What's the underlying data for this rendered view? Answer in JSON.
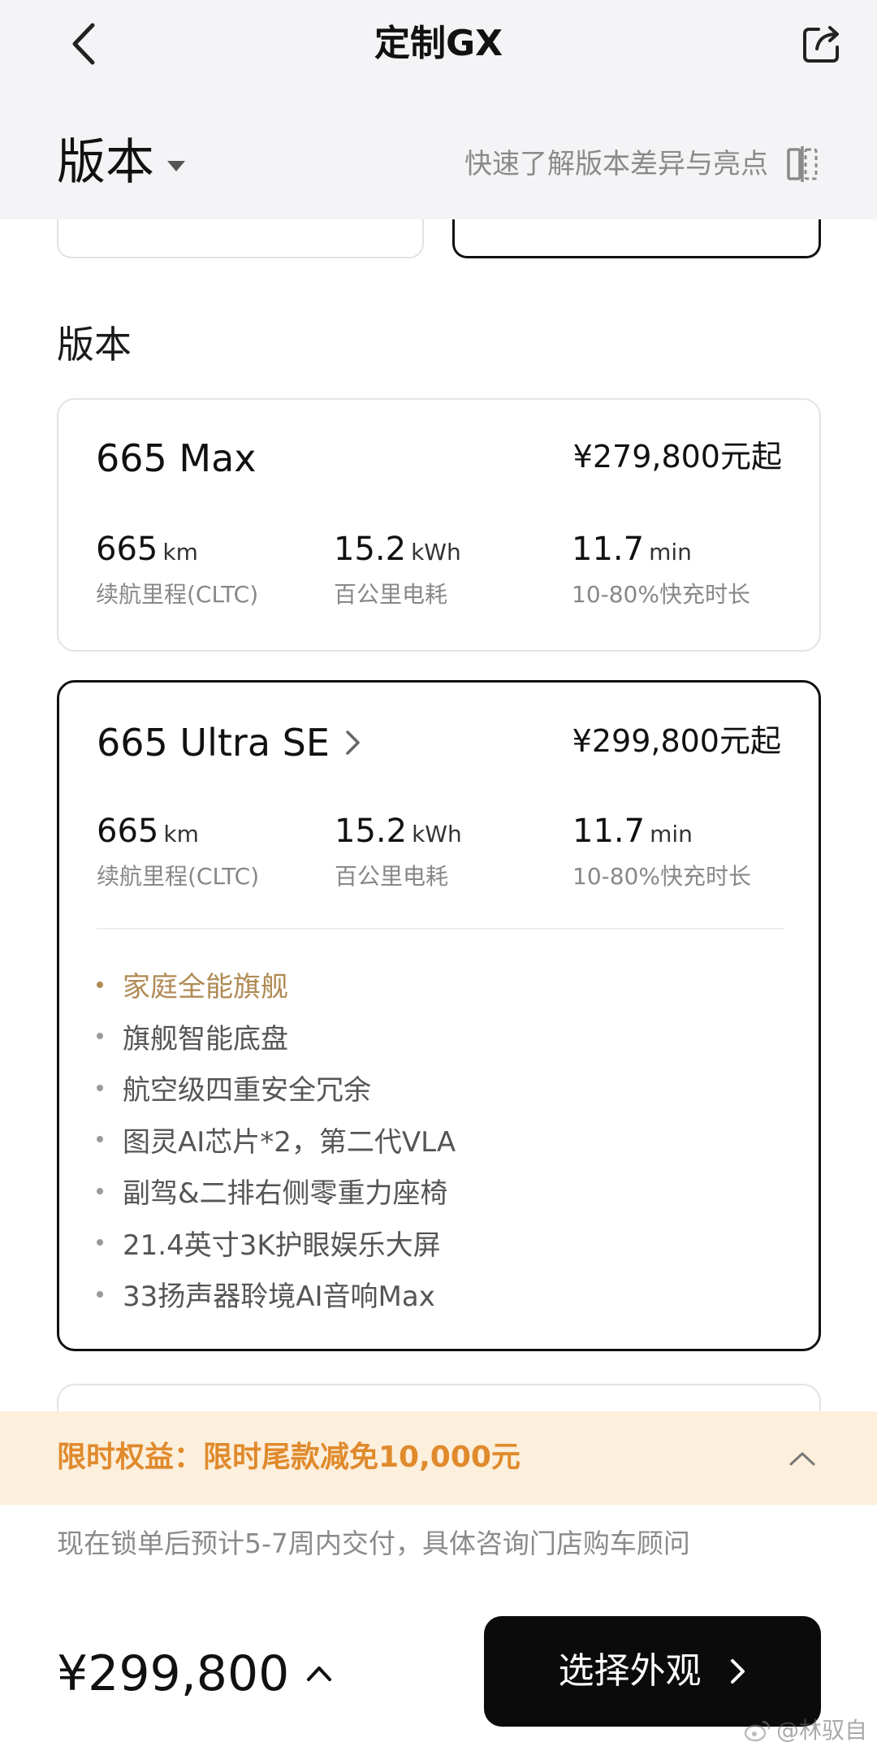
{
  "nav": {
    "title": "定制GX",
    "back_icon": "chevron-left-icon",
    "share_icon": "share-icon"
  },
  "header": {
    "section_title": "版本",
    "compare_link": "快速了解版本差异与亮点",
    "compare_icon": "compare-icon"
  },
  "main": {
    "version_label": "版本",
    "cards": [
      {
        "name": "665 Max",
        "price": "¥279,800元起",
        "selected": false,
        "specs": [
          {
            "value": "665",
            "unit": "km",
            "label": "续航里程(CLTC)"
          },
          {
            "value": "15.2",
            "unit": "kWh",
            "label": "百公里电耗"
          },
          {
            "value": "11.7",
            "unit": "min",
            "label": "10-80%快充时长"
          }
        ]
      },
      {
        "name": "665 Ultra SE",
        "price": "¥299,800元起",
        "selected": true,
        "specs": [
          {
            "value": "665",
            "unit": "km",
            "label": "续航里程(CLTC)"
          },
          {
            "value": "15.2",
            "unit": "kWh",
            "label": "百公里电耗"
          },
          {
            "value": "11.7",
            "unit": "min",
            "label": "10-80%快充时长"
          }
        ],
        "features": [
          "家庭全能旗舰",
          "旗舰智能底盘",
          "航空级四重安全冗余",
          "图灵AI芯片*2，第二代VLA",
          "副驾&二排右侧零重力座椅",
          "21.4英寸3K护眼娱乐大屏",
          "33扬声器聆境AI音响Max"
        ]
      }
    ]
  },
  "promo": {
    "text": "限时权益：限时尾款减免10,000元",
    "toggle_icon": "chevron-up-icon"
  },
  "delivery_note": "现在锁单后预计5-7周内交付，具体咨询门店购车顾问",
  "footer": {
    "total_price": "¥299,800",
    "button_label": "选择外观"
  },
  "watermark": "@林驭自",
  "colors": {
    "accent_gold": "#b08a54",
    "promo_orange": "#e08a2c",
    "promo_bg": "#fcefdc",
    "topbar_bg": "#f4f4f6",
    "button_bg": "#0b0b0b"
  }
}
